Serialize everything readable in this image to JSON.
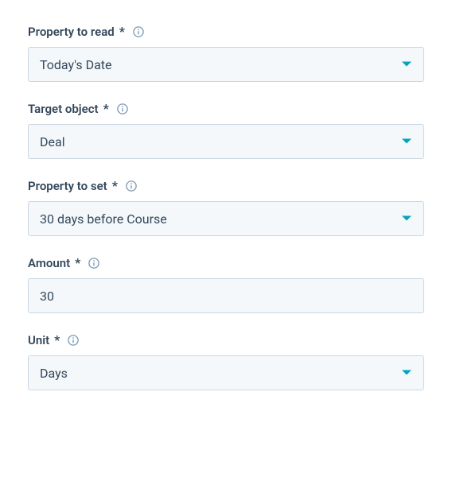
{
  "fields": {
    "propertyToRead": {
      "label": "Property to read",
      "value": "Today's Date"
    },
    "targetObject": {
      "label": "Target object",
      "value": "Deal"
    },
    "propertyToSet": {
      "label": "Property to set",
      "value": "30 days before Course"
    },
    "amount": {
      "label": "Amount",
      "value": "30"
    },
    "unit": {
      "label": "Unit",
      "value": "Days"
    }
  },
  "requiredMark": "*"
}
